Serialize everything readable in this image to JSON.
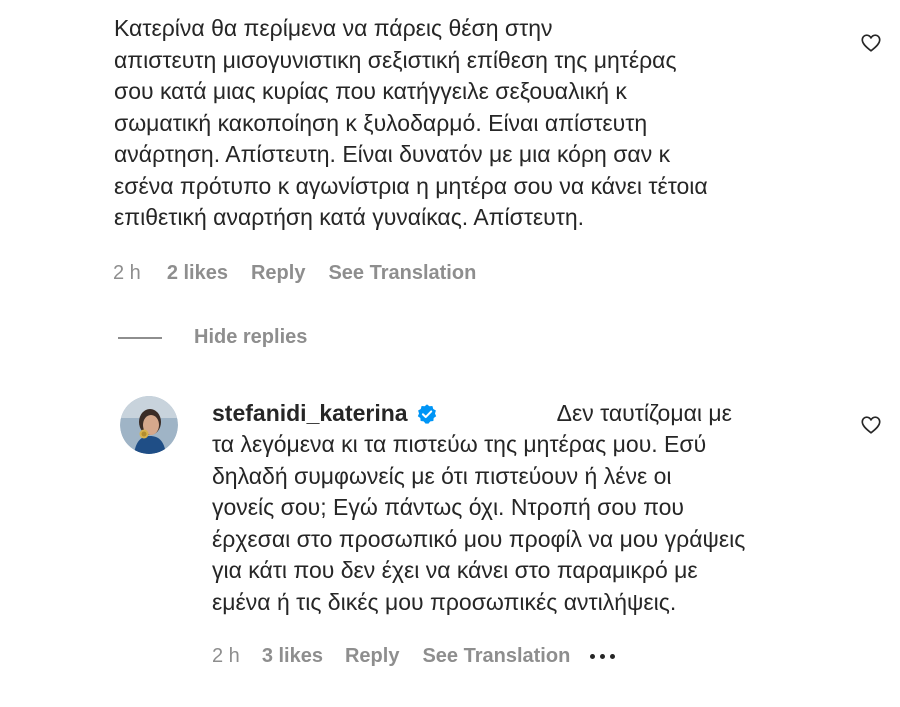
{
  "comment": {
    "text": "Κατερίνα θα περίμενα να πάρεις θέση στην\nαπιστευτη μισογυνιστικη σεξιστική επίθεση της μητέρας\nσου κατά μιας κυρίας που κατήγγειλε σεξουαλική κ\nσωματική κακοποίηση κ ξυλοδαρμό. Είναι απίστευτη\nανάρτηση. Απίστευτη. Είναι δυνατόν με μια κόρη σαν κ\nεσένα πρότυπο κ αγωνίστρια η μητέρα σου να κάνει τέτοια\nεπιθετική αναρτήση κατά γυναίκας. Απίστευτη.",
    "time": "2 h",
    "likes": "2 likes",
    "reply_label": "Reply",
    "translate_label": "See Translation",
    "like_icon": "heart-outline-icon"
  },
  "hide_replies": {
    "label": "Hide replies"
  },
  "reply": {
    "username": "stefanidi_katerina",
    "verified_icon": "verified-badge-icon",
    "verified_color": "#0095f6",
    "first_line": "Δεν ταυτίζομαι με",
    "text": "τα λεγόμενα κι τα πιστεύω της μητέρας μου. Εσύ\nδηλαδή συμφωνείς με ότι πιστεύουν ή λένε οι\nγονείς σου; Εγώ πάντως όχι. Ντροπή σου που\nέρχεσαι στο προσωπικό μου προφίλ να μου γράψεις\nγια κάτι που δεν έχει να κάνει στο παραμικρό με\nεμένα ή τις δικές μου προσωπικές αντιλήψεις.",
    "time": "2 h",
    "likes": "3 likes",
    "reply_label": "Reply",
    "translate_label": "See Translation",
    "more_icon": "more-options-icon",
    "like_icon": "heart-outline-icon"
  },
  "colors": {
    "text": "#262626",
    "secondary": "#8e8e8e",
    "background": "#ffffff"
  }
}
